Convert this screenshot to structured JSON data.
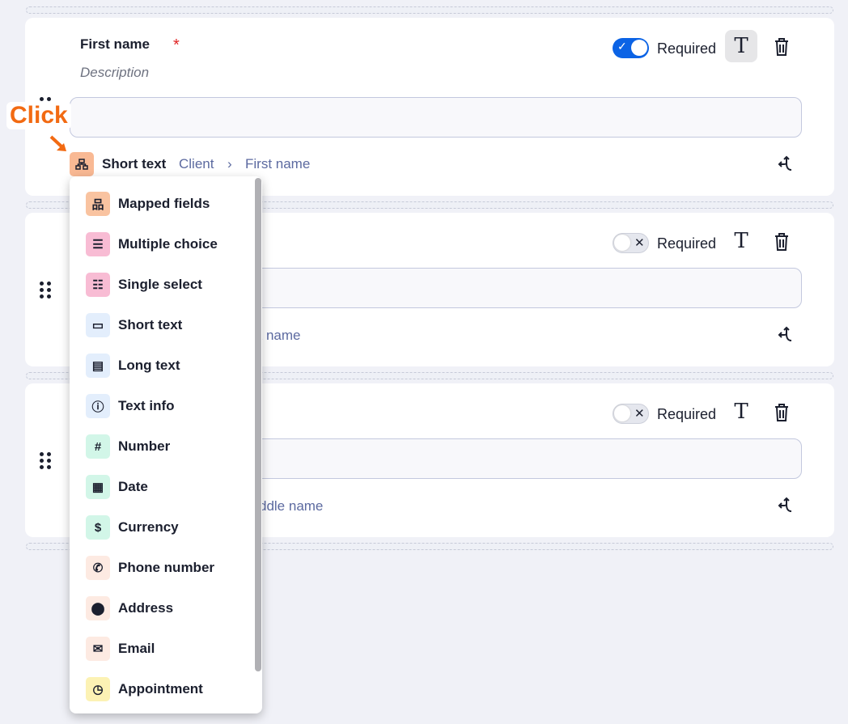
{
  "annotation": {
    "label": "Click",
    "color": "#f26a12"
  },
  "cards": [
    {
      "label": "First name",
      "required_mark": "*",
      "description": "Description",
      "required_label": "Required",
      "required": true,
      "field_type": "Short text",
      "mapping_object": "Client",
      "mapping_sep": "›",
      "mapping_field": "First name"
    },
    {
      "required_label": "Required",
      "required": false,
      "mapping_partial": "st name"
    },
    {
      "required_label": "Required",
      "required": false,
      "mapping_partial": "ddle name"
    }
  ],
  "menu": {
    "items": [
      {
        "label": "Mapped fields",
        "icon": "sitemap-icon",
        "bg": "#f9c3a0"
      },
      {
        "label": "Multiple choice",
        "icon": "list-icon",
        "bg": "#f8bcd4"
      },
      {
        "label": "Single select",
        "icon": "list-radio-icon",
        "bg": "#f8bcd4"
      },
      {
        "label": "Short text",
        "icon": "text-box-icon",
        "bg": "#e3eefc"
      },
      {
        "label": "Long text",
        "icon": "document-icon",
        "bg": "#e3eefc"
      },
      {
        "label": "Text info",
        "icon": "info-icon",
        "bg": "#e3eefc"
      },
      {
        "label": "Number",
        "icon": "hash-icon",
        "bg": "#d2f6e8"
      },
      {
        "label": "Date",
        "icon": "calendar-icon",
        "bg": "#d2f6e8"
      },
      {
        "label": "Currency",
        "icon": "dollar-icon",
        "bg": "#d2f6e8"
      },
      {
        "label": "Phone number",
        "icon": "phone-icon",
        "bg": "#fdeae2"
      },
      {
        "label": "Address",
        "icon": "map-pin-icon",
        "bg": "#fdeae2"
      },
      {
        "label": "Email",
        "icon": "envelope-icon",
        "bg": "#fdeae2"
      },
      {
        "label": "Appointment",
        "icon": "calendar-clock-icon",
        "bg": "#fcf2b4"
      }
    ]
  }
}
